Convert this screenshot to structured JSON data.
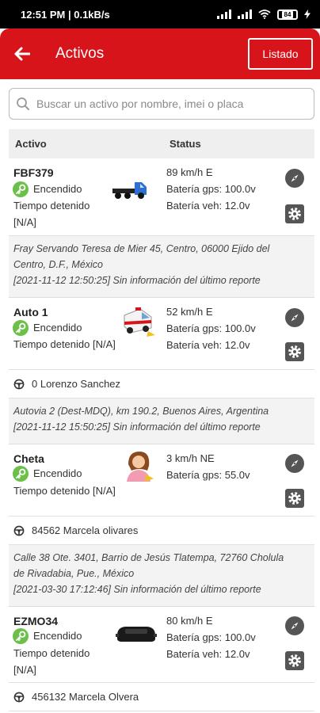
{
  "status_bar": {
    "time": "12:51 PM | 0.1kB/s",
    "battery": "84"
  },
  "header": {
    "title": "Activos",
    "back_icon": "arrow-left-icon",
    "listado_label": "Listado"
  },
  "search": {
    "placeholder": "Buscar un activo por nombre, imei o placa"
  },
  "table": {
    "col_activo": "Activo",
    "col_status": "Status"
  },
  "colors": {
    "brand_red": "#d7141a",
    "key_green": "#6cc04a",
    "icon_gray": "#555555"
  },
  "assets": [
    {
      "name": "FBF379",
      "state": "Encendido",
      "stopped": "Tiempo detenido",
      "stopped_value": "[N/A]",
      "speed": "89 km/h E",
      "gps": "Batería gps: 100.0v",
      "veh": "Batería veh: 12.0v",
      "image": "truck-icon",
      "address1": "Fray Servando Teresa de Mier 45, Centro, 06000 Ejido del",
      "address2": "Centro, D.F., México",
      "report": "[2021-11-12 12:50:25] Sin información del último reporte"
    },
    {
      "name": "Auto 1",
      "state": "Encendido",
      "stopped": "Tiempo detenido [N/A]",
      "speed": "52 km/h E",
      "gps": "Batería gps: 100.0v",
      "veh": "Batería veh: 12.0v",
      "image": "ambulance-icon",
      "driver": "0 Lorenzo Sanchez",
      "address1": "Autovia 2 (Dest-MDQ), km 190.2, Buenos Aires, Argentina",
      "report": "[2021-11-12 15:50:25] Sin información del último reporte"
    },
    {
      "name": "Cheta",
      "state": "Encendido",
      "stopped": "Tiempo detenido [N/A]",
      "speed": "3 km/h NE",
      "gps": "Batería gps: 55.0v",
      "image": "person-icon",
      "driver": "84562 Marcela olivares",
      "address1": "Calle 38 Ote. 3401, Barrio de Jesús Tlatempa, 72760 Cholula",
      "address2": "de Rivadabia, Pue., México",
      "report": "[2021-03-30 17:12:46] Sin información del último reporte"
    },
    {
      "name": "EZMO34",
      "state": "Encendido",
      "stopped": "Tiempo detenido",
      "stopped_value": "[N/A]",
      "speed": "80 km/h E",
      "gps": "Batería gps: 100.0v",
      "veh": "Batería veh: 12.0v",
      "image": "car-icon",
      "driver": "456132 Marcela Olvera"
    }
  ]
}
